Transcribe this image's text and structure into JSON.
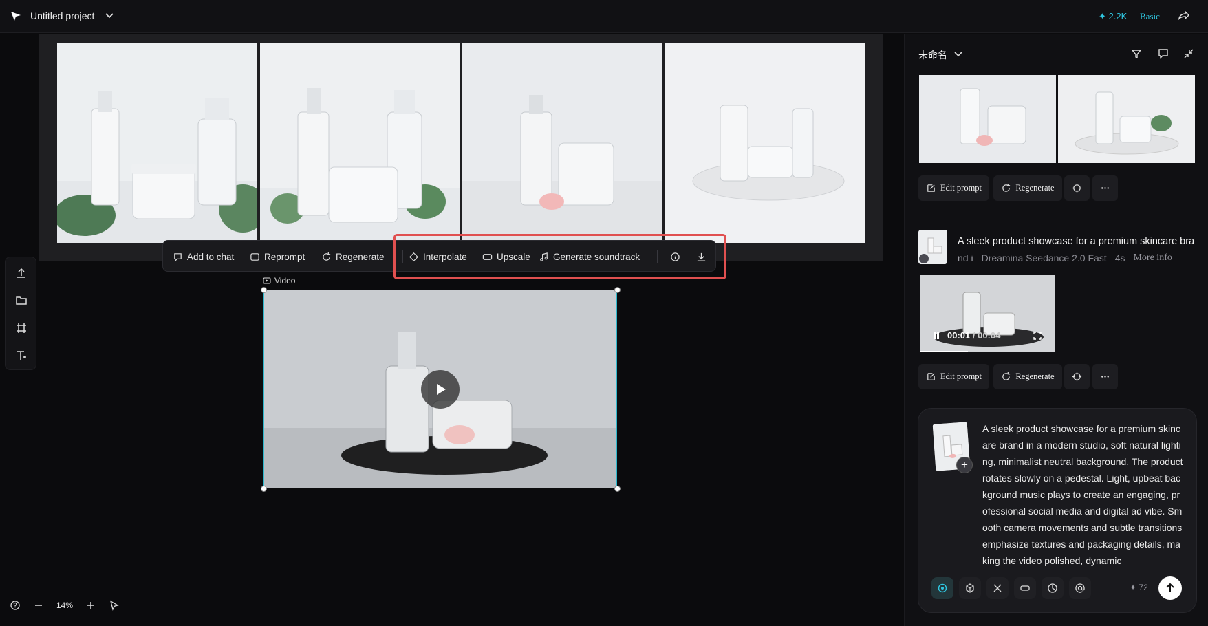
{
  "header": {
    "project_title": "Untitled project",
    "credits": "✦ 2.2K",
    "plan": "Basic"
  },
  "toolbar": {
    "add_to_chat": "Add to chat",
    "reprompt": "Reprompt",
    "regenerate": "Regenerate",
    "interpolate": "Interpolate",
    "upscale": "Upscale",
    "generate_soundtrack": "Generate soundtrack"
  },
  "canvas": {
    "video_label": "Video",
    "zoom": "14%"
  },
  "panel": {
    "title": "未命名",
    "actions": {
      "edit_prompt": "Edit prompt",
      "regenerate": "Regenerate"
    },
    "generation": {
      "title": "A sleek product showcase for a premium skincare bra",
      "title_cont": "nd i",
      "model": "Dreamina Seedance 2.0 Fast",
      "duration": "4s",
      "more_info": "More info",
      "time_current": "00:01",
      "time_total": "/ 00:04"
    }
  },
  "chat": {
    "prompt": "A sleek product showcase for a premium skincare brand in a modern studio, soft natural lighting, minimalist neutral background. The product rotates slowly on a pedestal. Light, upbeat background music plays to create an engaging, professional social media and digital ad vibe. Smooth camera movements and subtle transitions emphasize textures and packaging details, making the video polished, dynamic",
    "credit": "✦ 72"
  },
  "icons": {
    "logo": "logo-icon",
    "share": "share-icon",
    "play": "play-icon",
    "send": "arrow-up-icon"
  },
  "colors": {
    "accent": "#2fc6e0",
    "highlight": "#e05050",
    "background": "#0b0b0d"
  }
}
